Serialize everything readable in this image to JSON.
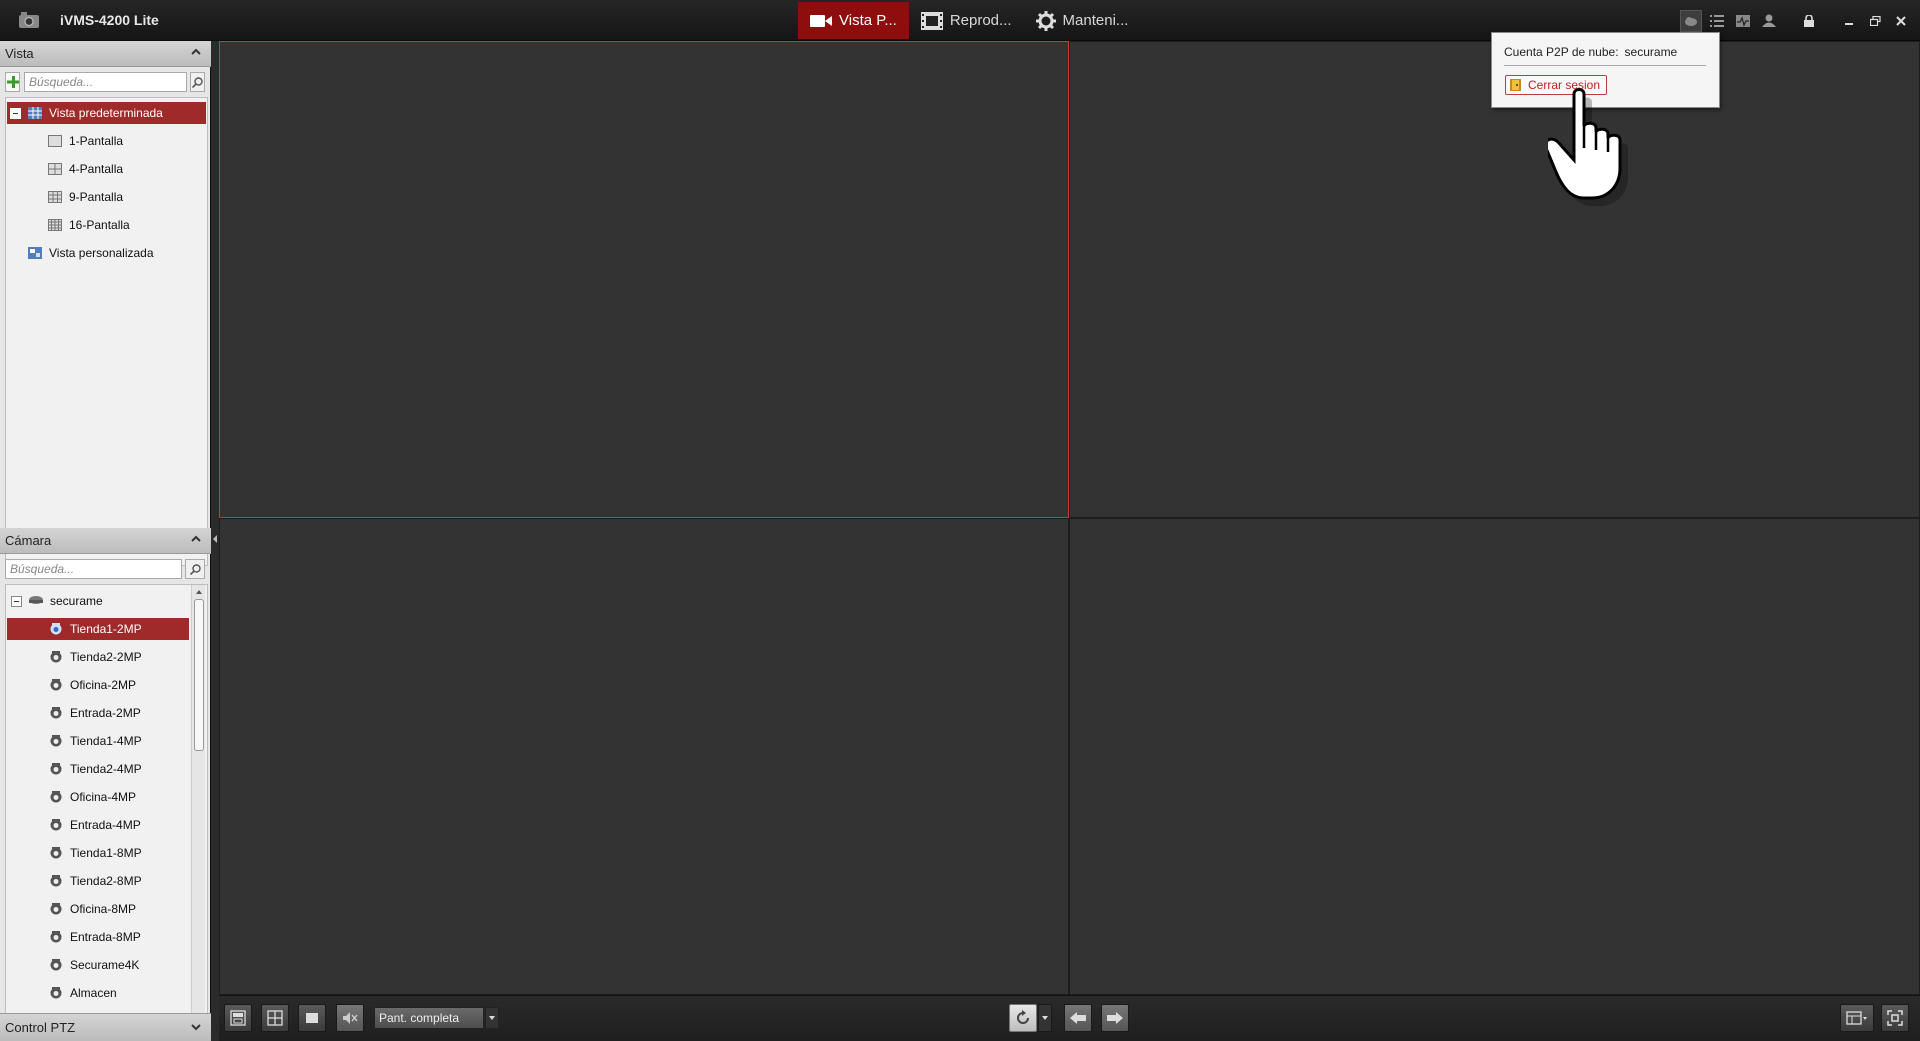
{
  "app": {
    "title": "iVMS-4200 Lite"
  },
  "nav": {
    "tabs": [
      {
        "label": "Vista P...",
        "active": true
      },
      {
        "label": "Reprod...",
        "active": false
      },
      {
        "label": "Manteni...",
        "active": false
      }
    ]
  },
  "vista_panel": {
    "title": "Vista",
    "search_placeholder": "Búsqueda...",
    "items": [
      {
        "label": "Vista predeterminada",
        "selected": true
      },
      {
        "label": "1-Pantalla"
      },
      {
        "label": "4-Pantalla"
      },
      {
        "label": "9-Pantalla"
      },
      {
        "label": "16-Pantalla"
      },
      {
        "label": "Vista personalizada"
      }
    ]
  },
  "camera_panel": {
    "title": "Cámara",
    "search_placeholder": "Búsqueda...",
    "root": "securame",
    "cameras": [
      "Tienda1-2MP",
      "Tienda2-2MP",
      "Oficina-2MP",
      "Entrada-2MP",
      "Tienda1-4MP",
      "Tienda2-4MP",
      "Oficina-4MP",
      "Entrada-4MP",
      "Tienda1-8MP",
      "Tienda2-8MP",
      "Oficina-8MP",
      "Entrada-8MP",
      "Securame4K",
      "Almacen"
    ],
    "selected_index": 0
  },
  "ptz_panel": {
    "title": "Control PTZ"
  },
  "bottombar": {
    "mode_select": "Pant. completa"
  },
  "popup": {
    "account_label": "Cuenta P2P de nube:",
    "account_value": "securame",
    "logout_label": "Cerrar sesion"
  },
  "colors": {
    "accent": "#8e0d0d",
    "selection": "#9e2a2a",
    "active_pane_border": "#c43a3a"
  }
}
